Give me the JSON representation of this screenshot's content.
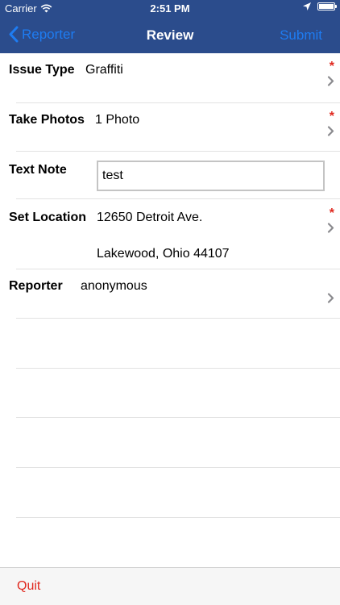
{
  "status_bar": {
    "carrier": "Carrier",
    "time": "2:51 PM"
  },
  "nav": {
    "back_label": "Reporter",
    "title": "Review",
    "submit_label": "Submit",
    "accent_color": "#1e7cf2",
    "bar_color": "#2b4c8c"
  },
  "rows": {
    "issue_type": {
      "label": "Issue Type",
      "value": "Graffiti",
      "required": "*"
    },
    "take_photos": {
      "label": "Take Photos",
      "value": "1 Photo",
      "required": "*"
    },
    "text_note": {
      "label": "Text Note",
      "value": "test"
    },
    "set_location": {
      "label": "Set Location",
      "line1": "12650 Detroit Ave.",
      "line2": "Lakewood, Ohio 44107",
      "required": "*"
    },
    "reporter": {
      "label": "Reporter",
      "value": "anonymous"
    }
  },
  "bottom": {
    "quit_label": "Quit",
    "quit_color": "#e0281e"
  }
}
